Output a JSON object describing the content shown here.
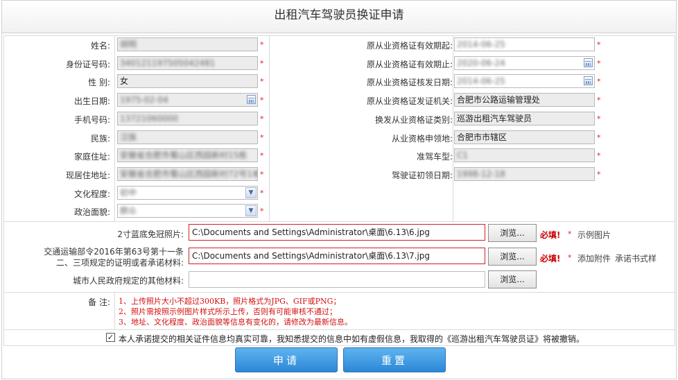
{
  "title": "出租汽车驾驶员换证申请",
  "left_fields": [
    {
      "label": "姓名:",
      "value": "胡明",
      "type": "text"
    },
    {
      "label": "身份证号码:",
      "value": "340121197505042481",
      "type": "text"
    },
    {
      "label": "性 别:",
      "value": "女",
      "type": "text"
    },
    {
      "label": "出生日期:",
      "value": "1975-02-04",
      "type": "date"
    },
    {
      "label": "手机号码:",
      "value": "13721060000",
      "type": "text"
    },
    {
      "label": "民族:",
      "value": "汉族",
      "type": "text"
    },
    {
      "label": "家庭住址:",
      "value": "安徽省合肥市蜀山区西园新村15栋",
      "type": "text"
    },
    {
      "label": "现居住地址:",
      "value": "安徽省合肥市蜀山区西园新村72号1单",
      "type": "text"
    },
    {
      "label": "文化程度:",
      "value": "初中",
      "type": "select"
    },
    {
      "label": "政治面貌:",
      "value": "群众",
      "type": "select"
    }
  ],
  "right_fields": [
    {
      "label": "原从业资格证有效期起:",
      "value": "2014-06-25",
      "type": "text"
    },
    {
      "label": "原从业资格证有效期止:",
      "value": "2020-06-24",
      "type": "date"
    },
    {
      "label": "原从业资格证核发日期:",
      "value": "2014-06-25",
      "type": "date"
    },
    {
      "label": "原从业资格证发证机关:",
      "value": "合肥市公路运输管理处",
      "type": "text"
    },
    {
      "label": "换发从业资格证类别:",
      "value": "巡游出租汽车驾驶员",
      "type": "text"
    },
    {
      "label": "从业资格申领地:",
      "value": "合肥市市辖区",
      "type": "text"
    },
    {
      "label": "准驾车型:",
      "value": "C1",
      "type": "text"
    },
    {
      "label": "驾驶证初领日期:",
      "value": "1998-12-18",
      "type": "text"
    }
  ],
  "star": "*",
  "uploads": [
    {
      "label": "2寸蓝底免冠照片:",
      "value": "C:\\Documents and Settings\\Administrator\\桌面\\6.13\\6.jpg",
      "browse": "浏览...",
      "required": "必填!",
      "links": [
        "示例图片"
      ]
    },
    {
      "label_line1": "交通运输部令2016年第63号第十一条",
      "label_line2": "二、三项规定的证明或者承诺材料:",
      "value": "C:\\Documents and Settings\\Administrator\\桌面\\6.13\\7.jpg",
      "browse": "浏览...",
      "required": "必填!",
      "links": [
        "添加附件",
        "承诺书式样"
      ]
    },
    {
      "label": "城市人民政府规定的其他材料:",
      "value": "",
      "browse": "浏览..."
    }
  ],
  "remarks": {
    "label": "备 注:",
    "lines": [
      "1、上传照片大小不超过300KB，照片格式为JPG、GIF或PNG；",
      "2、照片需按照示例图片样式所示上传，否则有可能审核不通过；",
      "3、地址、文化程度、政治面貌等信息有变化的，请修改为最新信息。"
    ]
  },
  "agreement": {
    "checked": true,
    "text": "本人承诺提交的相关证件信息均真实可靠，我知悉提交的信息中如有虚假信息，我取得的《巡游出租汽车驾驶员证》将被撤销。"
  },
  "buttons": {
    "submit": "申请",
    "reset": "重置"
  }
}
